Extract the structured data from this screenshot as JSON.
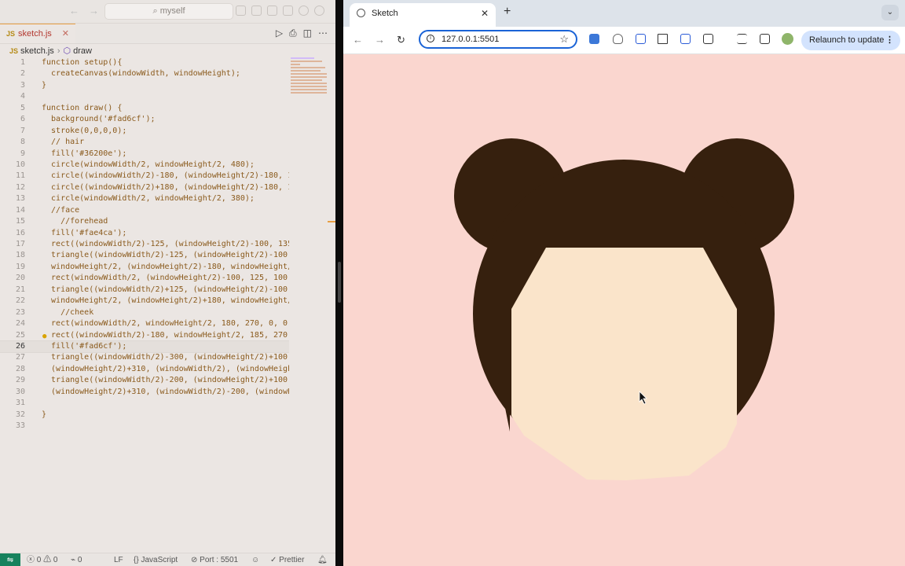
{
  "editor": {
    "search_text": "myself",
    "tab_label": "sketch.js",
    "tab_close": "✕",
    "breadcrumb": {
      "file": "sketch.js",
      "symbol": "draw"
    },
    "code_lines": [
      {
        "num": "1",
        "text": "function setup(){"
      },
      {
        "num": "2",
        "text": "  createCanvas(windowWidth, windowHeight);"
      },
      {
        "num": "3",
        "text": "}"
      },
      {
        "num": "4",
        "text": ""
      },
      {
        "num": "5",
        "text": "function draw() {"
      },
      {
        "num": "6",
        "text": "  background('#fad6cf');"
      },
      {
        "num": "7",
        "text": "  stroke(0,0,0,0);"
      },
      {
        "num": "8",
        "text": "  // hair"
      },
      {
        "num": "9",
        "text": "  fill('#36200e');"
      },
      {
        "num": "10",
        "text": "  circle(windowWidth/2, windowHeight/2, 480);"
      },
      {
        "num": "11",
        "text": "  circle((windowWidth/2)-180, (windowHeight/2)-180, 180"
      },
      {
        "num": "12",
        "text": "  circle((windowWidth/2)+180, (windowHeight/2)-180, 180"
      },
      {
        "num": "13",
        "text": "  circle(windowWidth/2, windowHeight/2, 380);"
      },
      {
        "num": "14",
        "text": "  //face"
      },
      {
        "num": "15",
        "text": "    //forehead"
      },
      {
        "num": "16",
        "text": "  fill('#fae4ca');"
      },
      {
        "num": "17",
        "text": "  rect((windowWidth/2)-125, (windowHeight/2)-100, 135,"
      },
      {
        "num": "18",
        "text": "  triangle((windowWidth/2)-125, (windowHeight/2)-100,"
      },
      {
        "num": "19",
        "text": "  windowHeight/2, (windowHeight/2)-180, windowHeight/2)"
      },
      {
        "num": "20",
        "text": "  rect(windowWidth/2, (windowHeight/2)-100, 125, 100, 0"
      },
      {
        "num": "21",
        "text": "  triangle((windowWidth/2)+125, (windowHeight/2)-100,"
      },
      {
        "num": "22",
        "text": "  windowHeight/2, (windowHeight/2)+180, windowHeight/2)"
      },
      {
        "num": "23",
        "text": "    //cheek"
      },
      {
        "num": "24",
        "text": "  rect(windowWidth/2, windowHeight/2, 180, 270, 0, 0, 1"
      },
      {
        "num": "25",
        "text": "  rect((windowWidth/2)-180, windowHeight/2, 185, 270, 0"
      },
      {
        "num": "26",
        "text": "  fill('#fad6cf');"
      },
      {
        "num": "27",
        "text": "  triangle((windowWidth/2)-300, (windowHeight/2)+100,"
      },
      {
        "num": "28",
        "text": "  (windowHeight/2)+310, (windowWidth/2), (windowHeight/"
      },
      {
        "num": "29",
        "text": "  triangle((windowWidth/2)-200, (windowHeight/2)+100,"
      },
      {
        "num": "30",
        "text": "  (windowHeight/2)+310, (windowWidth/2)-200, (windowHe"
      },
      {
        "num": "31",
        "text": ""
      },
      {
        "num": "32",
        "text": "}"
      },
      {
        "num": "33",
        "text": ""
      }
    ],
    "status": {
      "errors": "0",
      "warnings": "0",
      "ports": "0",
      "eol": "LF",
      "language": "JavaScript",
      "port": "Port : 5501",
      "formatter": "Prettier"
    }
  },
  "browser": {
    "tab_title": "Sketch",
    "url": "127.0.0.1:5501",
    "relaunch_label": "Relaunch to update",
    "canvas_bg": "#fad6cf",
    "hair_color": "#36200e",
    "face_color": "#fae4ca"
  }
}
